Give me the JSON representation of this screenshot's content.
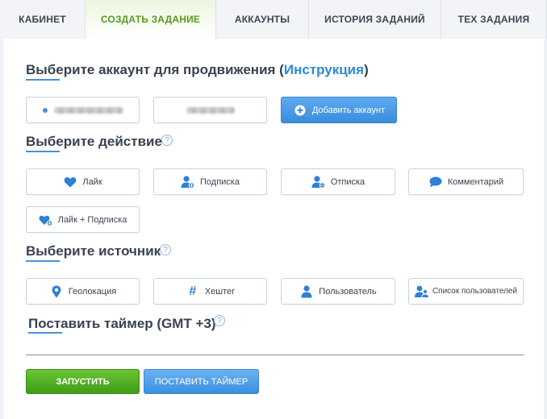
{
  "tabs": [
    "КАБИНЕТ",
    "СОЗДАТЬ ЗАДАНИЕ",
    "АККАУНТЫ",
    "ИСТОРИЯ ЗАДАНИЙ",
    "ТЕХ ЗАДАНИЯ"
  ],
  "accounts": {
    "heading": "Выберите аккаунт для продвижения (",
    "link": "Инструкция",
    "heading_end": ")",
    "add_button": "Добавить аккаунт"
  },
  "actions": {
    "heading": "Выберите действие",
    "help": "?",
    "items": [
      "Лайк",
      "Подписка",
      "Отписка",
      "Комментарий",
      "Лайк + Подписка"
    ]
  },
  "sources": {
    "heading": "Выберите источник",
    "help": "?",
    "items": [
      "Геолокация",
      "Хештег",
      "Пользователь",
      "Список пользователей"
    ]
  },
  "timer": {
    "heading": "Поставить таймер (GMT +3)",
    "help": "?"
  },
  "footer": {
    "start_label": "ЗАПУСТИТЬ",
    "timer_label": "ПОСТАВИТЬ ТАЙМЕР"
  },
  "colors": {
    "accent": "#4a90d9",
    "link": "#2a8bd6",
    "start_green": "#4caf22",
    "active_tab_text": "#5a9a1e"
  }
}
